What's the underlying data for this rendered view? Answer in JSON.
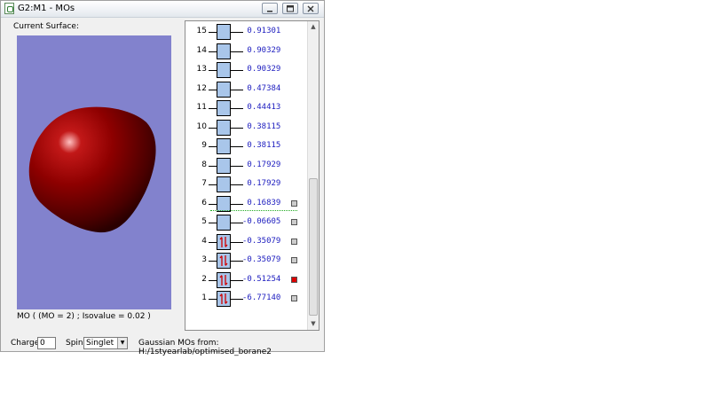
{
  "window": {
    "title": "G2:M1 - MOs",
    "buttons": {
      "minimize": "minimize-icon",
      "maximize": "maximize-icon",
      "close": "close-icon"
    }
  },
  "surface": {
    "label": "Current Surface:",
    "caption": "MO ( (MO = 2) ; Isovalue = 0.02 )",
    "background_color": "#8282cd",
    "surface_color": "#8b0000"
  },
  "orbitals": [
    {
      "index": "15",
      "energy": " 0.91301",
      "occupied": false,
      "selectable": false,
      "selected": false
    },
    {
      "index": "14",
      "energy": " 0.90329",
      "occupied": false,
      "selectable": false,
      "selected": false
    },
    {
      "index": "13",
      "energy": " 0.90329",
      "occupied": false,
      "selectable": false,
      "selected": false
    },
    {
      "index": "12",
      "energy": " 0.47384",
      "occupied": false,
      "selectable": false,
      "selected": false
    },
    {
      "index": "11",
      "energy": " 0.44413",
      "occupied": false,
      "selectable": false,
      "selected": false
    },
    {
      "index": "10",
      "energy": " 0.38115",
      "occupied": false,
      "selectable": false,
      "selected": false
    },
    {
      "index": "9",
      "energy": " 0.38115",
      "occupied": false,
      "selectable": false,
      "selected": false
    },
    {
      "index": "8",
      "energy": " 0.17929",
      "occupied": false,
      "selectable": false,
      "selected": false
    },
    {
      "index": "7",
      "energy": " 0.17929",
      "occupied": false,
      "selectable": false,
      "selected": false
    },
    {
      "index": "6",
      "energy": " 0.16839",
      "occupied": false,
      "selectable": true,
      "selected": false
    },
    {
      "index": "5",
      "energy": "-0.06605",
      "occupied": false,
      "selectable": true,
      "selected": false
    },
    {
      "index": "4",
      "energy": "-0.35079",
      "occupied": true,
      "selectable": true,
      "selected": false
    },
    {
      "index": "3",
      "energy": "-0.35079",
      "occupied": true,
      "selectable": true,
      "selected": false
    },
    {
      "index": "2",
      "energy": "-0.51254",
      "occupied": true,
      "selectable": true,
      "selected": true
    },
    {
      "index": "1",
      "energy": "-6.77140",
      "occupied": true,
      "selectable": true,
      "selected": false
    }
  ],
  "colors": {
    "energy_text": "#2020c0",
    "orbital_box": "#a9c6ea",
    "selected_marker": "#dd0000",
    "homo_lumo_line": "#22aa22"
  },
  "bottom": {
    "charge_label": "Charge:",
    "charge_value": "0",
    "spin_label": "Spin:",
    "spin_value": "Singlet",
    "source_text": "Gaussian MOs from:  H:/1styearlab/optimised_borane2"
  }
}
